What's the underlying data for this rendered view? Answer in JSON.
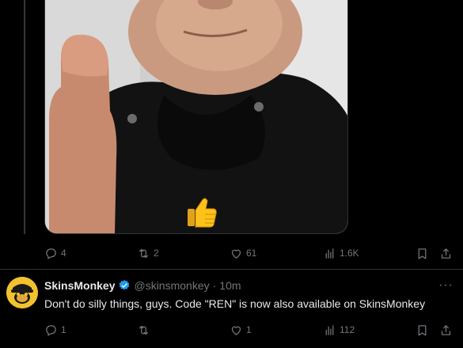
{
  "top_tweet": {
    "actions": {
      "reply_count": "4",
      "retweet_count": "2",
      "like_count": "61",
      "view_count": "1.6K"
    }
  },
  "reply_tweet": {
    "author_name": "SkinsMonkey",
    "author_handle": "@skinsmonkey",
    "separator": "·",
    "time": "10m",
    "more_label": "···",
    "text": "Don't do silly things, guys. Code \"REN\" is now also available on SkinsMonkey",
    "actions": {
      "reply_count": "1",
      "retweet_count": "",
      "like_count": "1",
      "view_count": "112"
    }
  },
  "colors": {
    "background": "#000000",
    "text": "#e7e9ea",
    "muted": "#71767b",
    "verified": "#1d9bf0",
    "avatar": "#f2c12e"
  },
  "icons": [
    "reply-icon",
    "retweet-icon",
    "like-icon",
    "views-icon",
    "bookmark-icon",
    "share-icon",
    "verified-badge-icon",
    "thumbs-up-emoji"
  ]
}
